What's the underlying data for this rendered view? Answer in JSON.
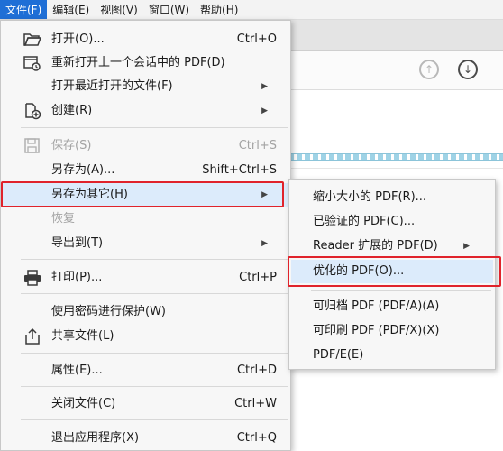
{
  "menubar": {
    "items": [
      {
        "label": "文件(F)",
        "active": true
      },
      {
        "label": "编辑(E)",
        "active": false
      },
      {
        "label": "视图(V)",
        "active": false
      },
      {
        "label": "窗口(W)",
        "active": false
      },
      {
        "label": "帮助(H)",
        "active": false
      }
    ]
  },
  "toolbar": {
    "up_icon": "arrow-up-circle-icon",
    "down_icon": "arrow-down-circle-icon"
  },
  "file_menu": {
    "items": [
      {
        "label": "打开(O)...",
        "shortcut": "Ctrl+O",
        "icon": "folder-open-icon"
      },
      {
        "label": "重新打开上一个会话中的 PDF(D)",
        "shortcut": "",
        "icon": "reopen-session-icon"
      },
      {
        "label": "打开最近打开的文件(F)",
        "submenu": true
      },
      {
        "label": "创建(R)",
        "submenu": true,
        "icon": "create-pdf-icon"
      },
      {
        "label": "保存(S)",
        "shortcut": "Ctrl+S",
        "disabled": true,
        "icon": "save-disk-icon"
      },
      {
        "label": "另存为(A)...",
        "shortcut": "Shift+Ctrl+S"
      },
      {
        "label": "另存为其它(H)",
        "submenu": true,
        "highlighted": true
      },
      {
        "label": "恢复",
        "disabled": true
      },
      {
        "label": "导出到(T)",
        "submenu": true
      },
      {
        "label": "打印(P)...",
        "shortcut": "Ctrl+P",
        "icon": "printer-icon"
      },
      {
        "label": "使用密码进行保护(W)"
      },
      {
        "label": "共享文件(L)",
        "icon": "share-upload-icon"
      },
      {
        "label": "属性(E)...",
        "shortcut": "Ctrl+D"
      },
      {
        "label": "关闭文件(C)",
        "shortcut": "Ctrl+W"
      },
      {
        "label": "退出应用程序(X)",
        "shortcut": "Ctrl+Q"
      }
    ]
  },
  "save_as_other_submenu": {
    "items": [
      {
        "label": "缩小大小的 PDF(R)..."
      },
      {
        "label": "已验证的 PDF(C)..."
      },
      {
        "label": "Reader 扩展的 PDF(D)",
        "submenu": true
      },
      {
        "label": "优化的 PDF(O)...",
        "highlighted": true
      },
      {
        "label": "可归档 PDF (PDF/A)(A)"
      },
      {
        "label": "可印刷 PDF (PDF/X)(X)"
      },
      {
        "label": "PDF/E(E)"
      }
    ]
  },
  "colors": {
    "highlight_box": "#e0232b",
    "hover_bg": "#dcebfb",
    "active_menu": "#1f6fd6"
  }
}
